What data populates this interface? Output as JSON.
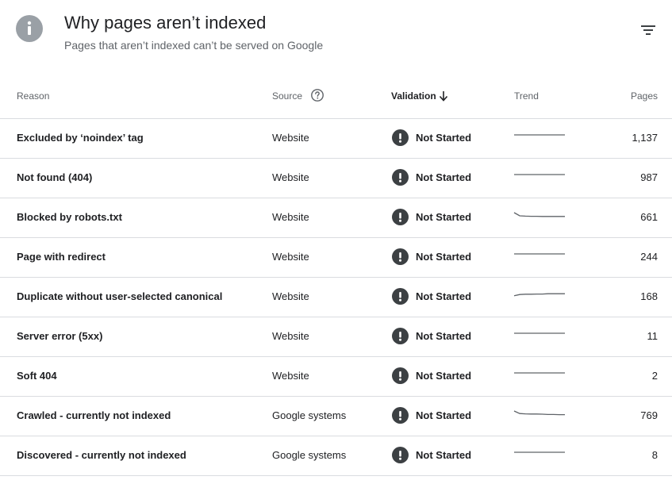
{
  "header": {
    "title": "Why pages aren’t indexed",
    "subtitle": "Pages that aren’t indexed can’t be served on Google",
    "icon": "info-icon",
    "filter_icon": "filter-icon"
  },
  "columns": {
    "reason": "Reason",
    "source": "Source",
    "validation": "Validation",
    "trend": "Trend",
    "pages": "Pages"
  },
  "colors": {
    "status_icon": "#3c4043",
    "trend_line": "#5f6368",
    "divider": "#dadce0",
    "info_icon_bg": "#9aa0a6"
  },
  "rows": [
    {
      "reason": "Excluded by ‘noindex’ tag",
      "source": "Website",
      "validation": "Not Started",
      "pages": "1,137",
      "trend": [
        2,
        2,
        2,
        2,
        2,
        2,
        2,
        2,
        2,
        2
      ]
    },
    {
      "reason": "Not found (404)",
      "source": "Website",
      "validation": "Not Started",
      "pages": "987",
      "trend": [
        2,
        2,
        2,
        2,
        2,
        2,
        2,
        2,
        2,
        2
      ]
    },
    {
      "reason": "Blocked by robots.txt",
      "source": "Website",
      "validation": "Not Started",
      "pages": "661",
      "trend": [
        1,
        3,
        3.2,
        3.3,
        3.3,
        3.4,
        3.4,
        3.4,
        3.4,
        3.4
      ]
    },
    {
      "reason": "Page with redirect",
      "source": "Website",
      "validation": "Not Started",
      "pages": "244",
      "trend": [
        2,
        2,
        2,
        2,
        2,
        2,
        2,
        2,
        2,
        2
      ]
    },
    {
      "reason": "Duplicate without user-selected canonical",
      "source": "Website",
      "validation": "Not Started",
      "pages": "168",
      "trend": [
        3.4,
        2.6,
        2.4,
        2.4,
        2.3,
        2.3,
        2.1,
        2.1,
        2.1,
        2.1
      ]
    },
    {
      "reason": "Server error (5xx)",
      "source": "Website",
      "validation": "Not Started",
      "pages": "11",
      "trend": [
        2,
        2,
        2,
        2,
        2,
        2,
        2,
        2,
        2,
        2
      ]
    },
    {
      "reason": "Soft 404",
      "source": "Website",
      "validation": "Not Started",
      "pages": "2",
      "trend": [
        2,
        2,
        2,
        2,
        2,
        2,
        2,
        2,
        2,
        2
      ]
    },
    {
      "reason": "Crawled - currently not indexed",
      "source": "Google systems",
      "validation": "Not Started",
      "pages": "769",
      "trend": [
        1,
        2.6,
        2.8,
        2.9,
        2.9,
        3.0,
        3.2,
        3.2,
        3.3,
        3.3
      ]
    },
    {
      "reason": "Discovered - currently not indexed",
      "source": "Google systems",
      "validation": "Not Started",
      "pages": "8",
      "trend": [
        2,
        2,
        2,
        2,
        2,
        2,
        2,
        2,
        2,
        2
      ]
    }
  ]
}
